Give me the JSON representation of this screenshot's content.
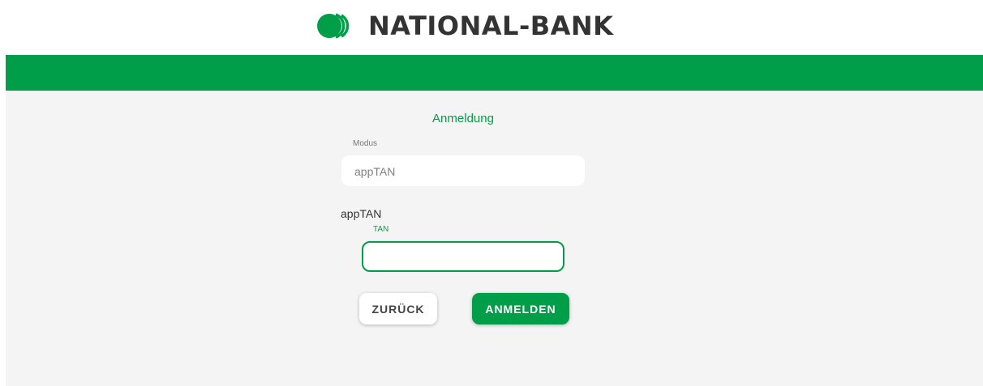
{
  "brand": {
    "name": "NATIONAL-BANK",
    "logo_icon": "national-bank-logo-icon",
    "color": "#009e49"
  },
  "login": {
    "title": "Anmeldung",
    "mode_label": "Modus",
    "mode_value": "appTAN",
    "section_label": "appTAN",
    "tan_label": "TAN",
    "tan_value": "",
    "back_button": "ZURÜCK",
    "login_button": "ANMELDEN"
  }
}
